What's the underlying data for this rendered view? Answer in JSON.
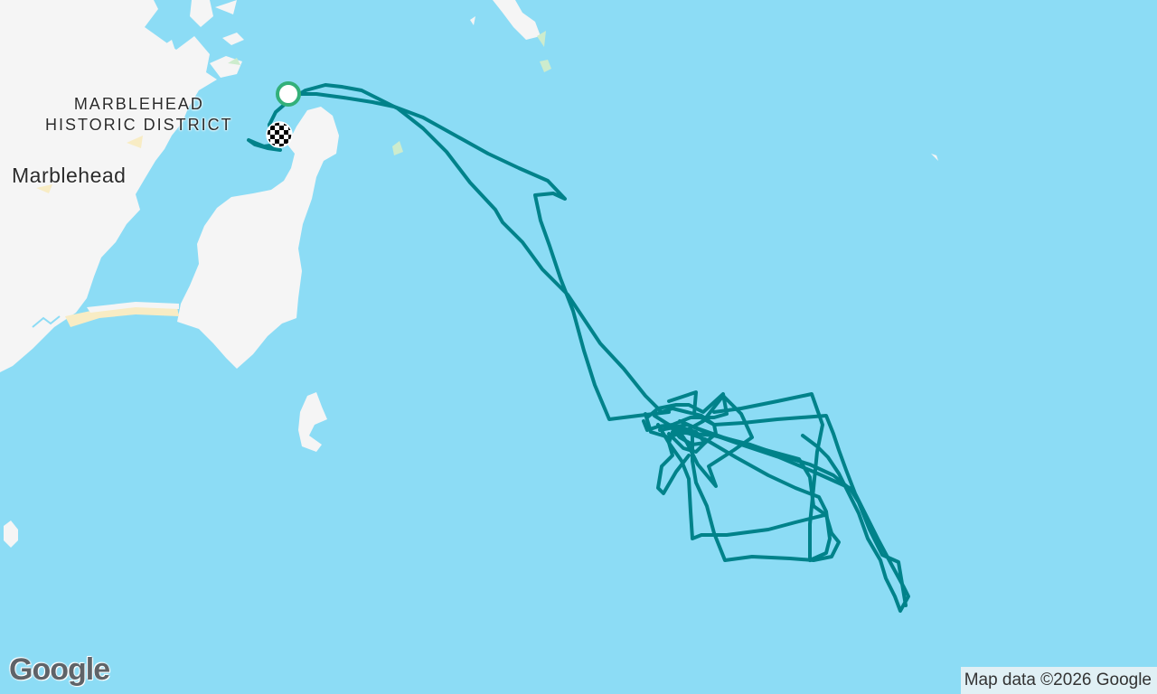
{
  "map": {
    "labels": {
      "district_line1": "MARBLEHEAD",
      "district_line2": "HISTORIC DISTRICT",
      "town": "Marblehead"
    },
    "attribution": "Map data ©2026 Google",
    "logo": "Google",
    "colors": {
      "water": "#8cdcf5",
      "land": "#f5f5f5",
      "beach": "#f8ecc4",
      "park": "#cdeccd",
      "track": "#00828a",
      "start_marker_fill": "#ffffff",
      "start_marker_ring": "#33b07a",
      "finish_marker": "checkered"
    },
    "track": {
      "start_marker": "start-circle",
      "finish_marker": "checkered-flag"
    }
  }
}
